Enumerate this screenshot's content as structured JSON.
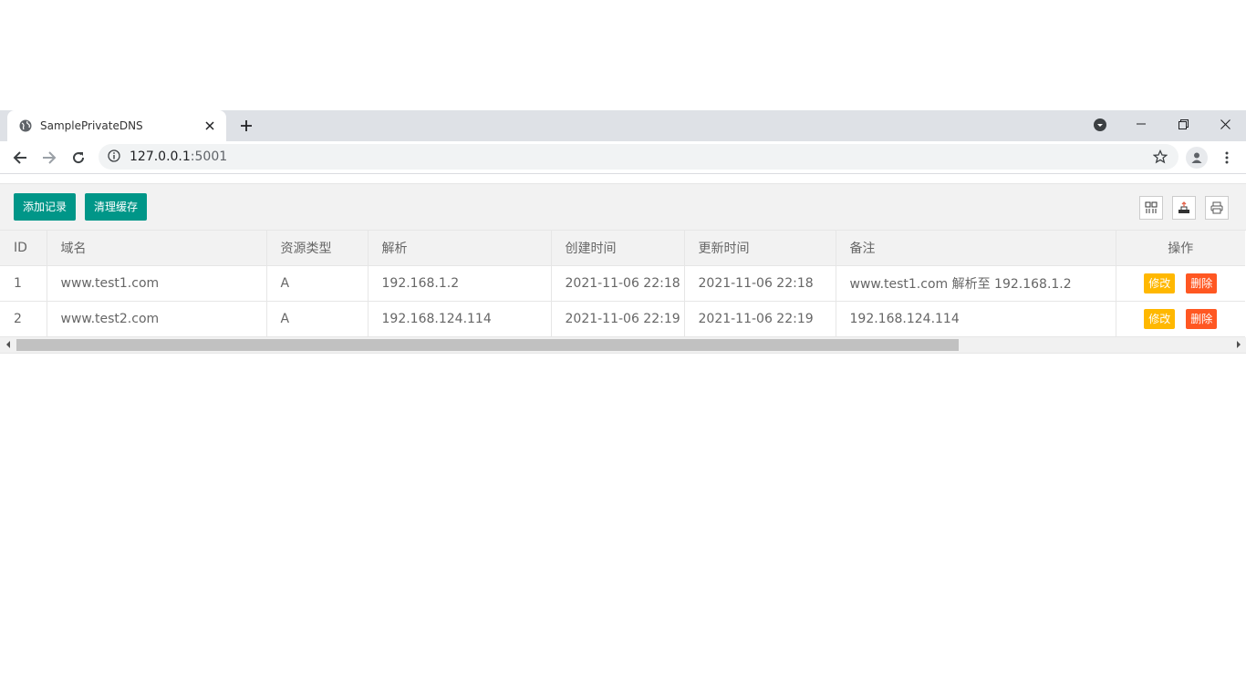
{
  "browser": {
    "tab_title": "SamplePrivateDNS",
    "url_host": "127.0.0.1",
    "url_port": ":5001"
  },
  "toolbar": {
    "add_label": "添加记录",
    "clear_cache_label": "清理缓存",
    "icons": [
      "columns-filter-icon",
      "export-icon",
      "print-icon"
    ]
  },
  "table": {
    "headers": {
      "id": "ID",
      "domain": "域名",
      "type": "资源类型",
      "resolve": "解析",
      "created": "创建时间",
      "updated": "更新时间",
      "note": "备注",
      "ops": "操作"
    },
    "rows": [
      {
        "id": "1",
        "domain": "www.test1.com",
        "type": "A",
        "resolve": "192.168.1.2",
        "created": "2021-11-06 22:18",
        "updated": "2021-11-06 22:18",
        "note": "www.test1.com 解析至 192.168.1.2",
        "edit": "修改",
        "delete": "删除"
      },
      {
        "id": "2",
        "domain": "www.test2.com",
        "type": "A",
        "resolve": "192.168.124.114",
        "created": "2021-11-06 22:19",
        "updated": "2021-11-06 22:19",
        "note": "192.168.124.114",
        "edit": "修改",
        "delete": "删除"
      }
    ]
  },
  "colors": {
    "primary_button": "#009688",
    "edit_button": "#ffb800",
    "delete_button": "#ff5722"
  }
}
